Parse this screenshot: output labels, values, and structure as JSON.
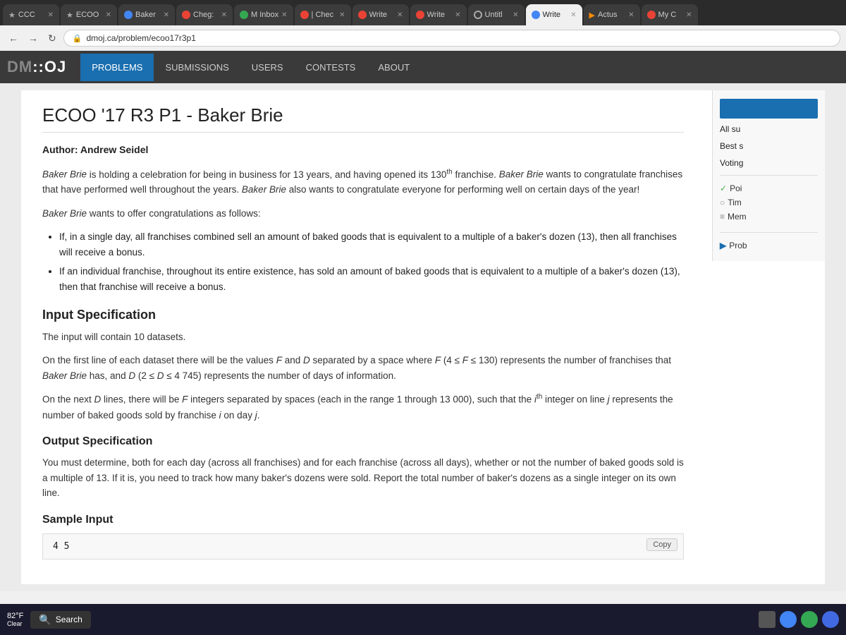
{
  "browser": {
    "tabs": [
      {
        "label": "CCC",
        "icon": "star",
        "active": false,
        "closeable": true
      },
      {
        "label": "ECOO",
        "icon": "star",
        "active": false,
        "closeable": true
      },
      {
        "label": "Baker",
        "icon": "g",
        "active": false,
        "closeable": true
      },
      {
        "label": "Cheg:",
        "icon": "c",
        "active": false,
        "closeable": true
      },
      {
        "label": "M Inbox",
        "icon": "m",
        "active": false,
        "closeable": true
      },
      {
        "label": "| Chec",
        "icon": "c",
        "active": false,
        "closeable": true
      },
      {
        "label": "Write",
        "icon": "c",
        "active": false,
        "closeable": true
      },
      {
        "label": "Write",
        "icon": "c",
        "active": false,
        "closeable": true
      },
      {
        "label": "Untitl",
        "icon": "o",
        "active": false,
        "closeable": true
      },
      {
        "label": "Write",
        "icon": "g",
        "active": false,
        "closeable": true
      },
      {
        "label": "Actus",
        "icon": "arrow",
        "active": false,
        "closeable": true
      },
      {
        "label": "My C",
        "icon": "c",
        "active": false,
        "closeable": true
      }
    ],
    "address": "dmoj.ca/problem/ecoo17r3p1"
  },
  "nav": {
    "logo": "DM::OJ",
    "items": [
      {
        "label": "PROBLEMS",
        "active": true
      },
      {
        "label": "SUBMISSIONS",
        "active": false
      },
      {
        "label": "USERS",
        "active": false
      },
      {
        "label": "CONTESTS",
        "active": false
      },
      {
        "label": "ABOUT",
        "active": false
      }
    ]
  },
  "page": {
    "title": "ECOO '17 R3 P1 - Baker Brie",
    "author_label": "Author:",
    "author_name": "Andrew Seidel",
    "intro_p1": "Baker Brie is holding a celebration for being in business for 13 years, and having opened its 130",
    "intro_p1_sup": "th",
    "intro_p1_cont": " franchise. Baker Brie wants to congratulate franchises that have performed well throughout the years. Baker Brie also wants to congratulate everyone for performing well on certain days of the year!",
    "intro_p2": "Baker Brie wants to offer congratulations as follows:",
    "bullet1": "If, in a single day, all franchises combined sell an amount of baked goods that is equivalent to a multiple of a baker's dozen (13), then all franchises will receive a bonus.",
    "bullet2": "If an individual franchise, throughout its entire existence, has sold an amount of baked goods that is equivalent to a multiple of a baker's dozen (13), then that franchise will receive a bonus.",
    "input_spec_title": "Input Specification",
    "input_p1": "The input will contain 10 datasets.",
    "input_p2": "On the first line of each dataset there will be the values F and D separated by a space where F (4 ≤ F ≤ 130) represents the number of franchises that Baker Brie has, and D (2 ≤ D ≤ 4745) represents the number of days of information.",
    "input_p3": "On the next D lines, there will be F integers separated by spaces (each in the range 1 through 13 000), such that the i",
    "input_p3_sup": "th",
    "input_p3_cont": " integer on line j represents the number of baked goods sold by franchise i on day j.",
    "output_spec_title": "Output Specification",
    "output_p1": "You must determine, both for each day (across all franchises) and for each franchise (across all days), whether or not the number of baked goods sold is a multiple of 13. If it is, you need to track how many baker's dozens were sold. Report the total number of baker's dozens as a single integer on its own line.",
    "sample_input_title": "Sample Input",
    "sample_input_value": "4 5",
    "copy_label": "Copy"
  },
  "sidebar": {
    "all_submissions_label": "All su",
    "best_score_label": "Best s",
    "voting_label": "Voting",
    "points_label": "Poi",
    "time_label": "Tim",
    "memory_label": "Mem",
    "prob_label": "Prob"
  }
}
